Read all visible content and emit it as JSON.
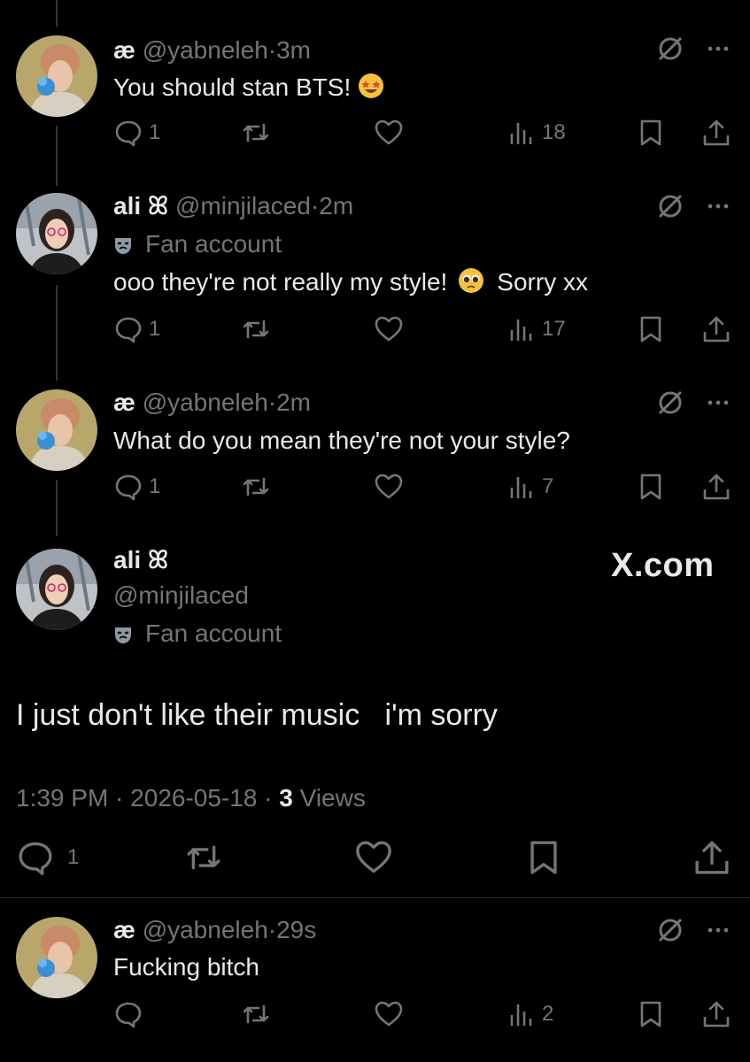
{
  "tweets": [
    {
      "name": "æ",
      "handle": "@yabneleh",
      "time": "3m",
      "text": "You should stan BTS!",
      "emoji": "star-struck-emoji",
      "replies": "1",
      "views": "18"
    },
    {
      "name": "ali ꕤ",
      "handle": "@minjilaced",
      "time": "2m",
      "badge": "Fan account",
      "text_before": "ooo they're not really my style!",
      "emoji": "pleading-face-emoji",
      "text_after": "Sorry xx",
      "replies": "1",
      "views": "17"
    },
    {
      "name": "æ",
      "handle": "@yabneleh",
      "time": "2m",
      "text": "What do you mean they're not your style?",
      "replies": "1",
      "views": "7"
    }
  ],
  "focused": {
    "name": "ali ꕤ",
    "handle": "@minjilaced",
    "badge": "Fan account",
    "watermark": "X.com",
    "text": "I just don't like their music   i'm sorry",
    "time": "1:39 PM",
    "date": "2026-05-18",
    "views_count": "3",
    "views_label": "Views",
    "replies": "1"
  },
  "reply": {
    "name": "æ",
    "handle": "@yabneleh",
    "time": "29s",
    "text": "Fucking bitch",
    "views": "2"
  },
  "separator": "·",
  "colors": {
    "background": "#000000",
    "text": "#e7e9ea",
    "muted": "#71767b",
    "line": "#333639"
  },
  "icons": [
    "reply-icon",
    "retweet-icon",
    "like-icon",
    "views-icon",
    "bookmark-icon",
    "share-icon",
    "grok-icon",
    "more-icon",
    "fan-account-mask-icon"
  ]
}
